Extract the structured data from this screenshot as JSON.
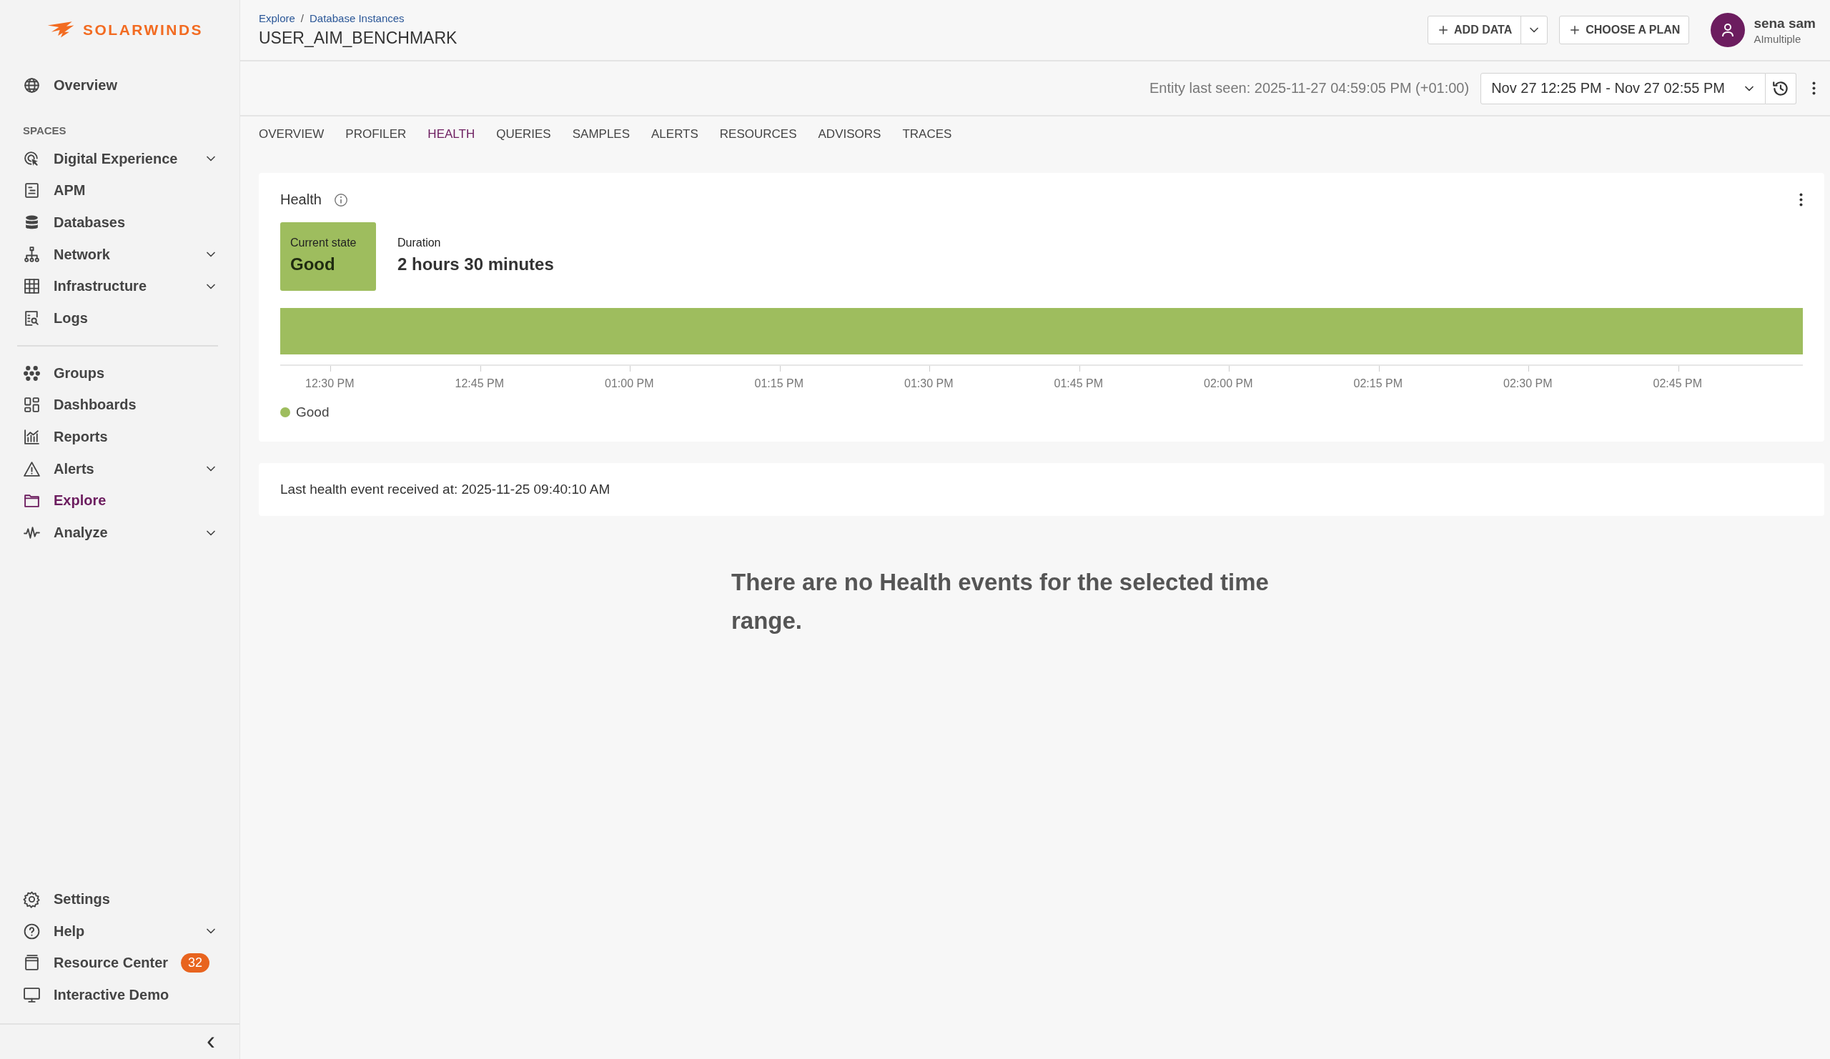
{
  "sidebar": {
    "logo": "SOLARWINDS",
    "top_items": [
      {
        "label": "Overview",
        "expandable": false,
        "selected": false
      }
    ],
    "section_label": "SPACES",
    "space_items": [
      {
        "label": "Digital Experience",
        "expandable": true,
        "selected": false
      },
      {
        "label": "APM",
        "expandable": false,
        "selected": false
      },
      {
        "label": "Databases",
        "expandable": false,
        "selected": false
      },
      {
        "label": "Network",
        "expandable": true,
        "selected": false
      },
      {
        "label": "Infrastructure",
        "expandable": true,
        "selected": false
      },
      {
        "label": "Logs",
        "expandable": false,
        "selected": false
      }
    ],
    "main_items": [
      {
        "label": "Groups",
        "expandable": false,
        "selected": false
      },
      {
        "label": "Dashboards",
        "expandable": false,
        "selected": false
      },
      {
        "label": "Reports",
        "expandable": false,
        "selected": false
      },
      {
        "label": "Alerts",
        "expandable": true,
        "selected": false
      },
      {
        "label": "Explore",
        "expandable": false,
        "selected": true
      },
      {
        "label": "Analyze",
        "expandable": true,
        "selected": false
      }
    ],
    "bottom_items": [
      {
        "label": "Settings",
        "expandable": false,
        "selected": false
      },
      {
        "label": "Help",
        "expandable": true,
        "selected": false
      },
      {
        "label": "Resource Center",
        "expandable": false,
        "selected": false,
        "badge": "32"
      },
      {
        "label": "Interactive Demo",
        "expandable": false,
        "selected": false
      }
    ],
    "collapse": "‹"
  },
  "header": {
    "breadcrumbs": [
      "Explore",
      "Database Instances"
    ],
    "separator": "/",
    "title": "USER_AIM_BENCHMARK",
    "buttons": [
      {
        "label": "ADD DATA",
        "split": true
      },
      {
        "label": "CHOOSE A PLAN",
        "split": false
      }
    ],
    "user": {
      "name": "sena sam",
      "org": "AImultiple"
    }
  },
  "toolbar": {
    "last_seen": "Entity last seen: 2025-11-27 04:59:05 PM (+01:00)",
    "time_range": "Nov 27 12:25 PM - Nov 27 02:55 PM"
  },
  "tabs": [
    {
      "label": "OVERVIEW",
      "selected": false
    },
    {
      "label": "PROFILER",
      "selected": false
    },
    {
      "label": "HEALTH",
      "selected": true
    },
    {
      "label": "QUERIES",
      "selected": false
    },
    {
      "label": "SAMPLES",
      "selected": false
    },
    {
      "label": "ALERTS",
      "selected": false
    },
    {
      "label": "RESOURCES",
      "selected": false
    },
    {
      "label": "ADVISORS",
      "selected": false
    },
    {
      "label": "TRACES",
      "selected": false
    }
  ],
  "health": {
    "title": "Health",
    "current_state": {
      "label": "Current state",
      "value": "Good",
      "color": "#9ebd5e"
    },
    "duration": {
      "label": "Duration",
      "value": "2 hours 30 minutes"
    },
    "timeline": {
      "segments": [
        {
          "color": "#9ebd5e"
        }
      ],
      "ticks": [
        "12:30 PM",
        "12:45 PM",
        "01:00 PM",
        "01:15 PM",
        "01:30 PM",
        "01:45 PM",
        "02:00 PM",
        "02:15 PM",
        "02:30 PM",
        "02:45 PM"
      ]
    },
    "legend": [
      {
        "label": "Good",
        "color": "#9ebd5e"
      }
    ]
  },
  "last_event": "Last health event received at: 2025-11-25 09:40:10 AM",
  "empty_message": "There are no Health events for the selected time range."
}
